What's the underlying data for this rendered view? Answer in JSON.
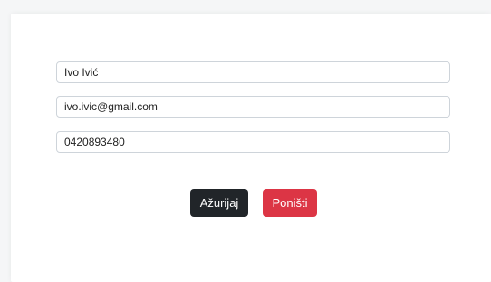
{
  "form": {
    "name_value": "Ivo Ivić",
    "email_value": "ivo.ivic@gmail.com",
    "phone_value": "0420893480"
  },
  "buttons": {
    "update_label": "Ažurijaj",
    "cancel_label": "Poništi"
  },
  "colors": {
    "update_button": "#212529",
    "cancel_button": "#dc3545"
  }
}
